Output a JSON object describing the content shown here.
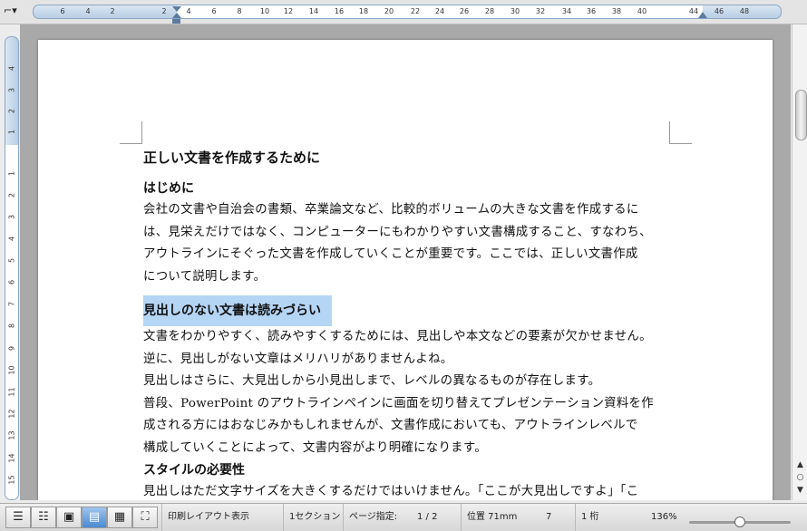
{
  "ruler": {
    "horizontal_numbers": [
      "6",
      "4",
      "2",
      "2",
      "4",
      "6",
      "8",
      "10",
      "12",
      "14",
      "16",
      "18",
      "20",
      "22",
      "24",
      "26",
      "28",
      "30",
      "32",
      "34",
      "36",
      "38",
      "40",
      "44",
      "46",
      "48"
    ],
    "vertical_numbers": [
      "4",
      "3",
      "2",
      "1",
      "1",
      "2",
      "3",
      "4",
      "5",
      "6",
      "7",
      "8",
      "9",
      "10",
      "11",
      "12",
      "13",
      "14",
      "15"
    ]
  },
  "document": {
    "title": "正しい文書を作成するために",
    "intro_heading": "はじめに",
    "intro_lines": [
      "会社の文書や自治会の書類、卒業論文など、比較的ボリュームの大きな文書を作成するに",
      "は、見栄えだけではなく、コンピューターにもわかりやすい文書構成すること、すなわち、",
      "アウトラインにそぐった文書を作成していくことが重要です。ここでは、正しい文書作成",
      "について説明します。"
    ],
    "noheading_heading": "見出しのない文書は読みづらい",
    "noheading_lines": [
      "文書をわかりやすく、読みやすくするためには、見出しや本文などの要素が欠かせません。",
      "逆に、見出しがない文章はメリハリがありませんよね。",
      "見出しはさらに、大見出しから小見出しまで、レベルの異なるものが存在します。",
      "普段、PowerPoint のアウトラインペインに画面を切り替えてプレゼンテーション資料を作",
      "成される方にはおなじみかもしれませんが、文書作成においても、アウトラインレベルで",
      "構成していくことによって、文書内容がより明確になります。"
    ],
    "style_heading": "スタイルの必要性",
    "style_lines": [
      "見出しはただ文字サイズを大きくするだけではいけません。「ここが大見出しですよ」「こ"
    ]
  },
  "statusbar": {
    "view_mode": "印刷レイアウト表示",
    "section": "1セクション",
    "page_label": "ページ指定:",
    "page_value": "1 / 2",
    "position": "位置 71mm",
    "line": "7",
    "column": "1 桁",
    "zoom": "136%"
  },
  "colors": {
    "selection_highlight": "#b5d5f5",
    "ruler_blue": "#b8cde3",
    "active_view_button": "#4a8ad2"
  }
}
